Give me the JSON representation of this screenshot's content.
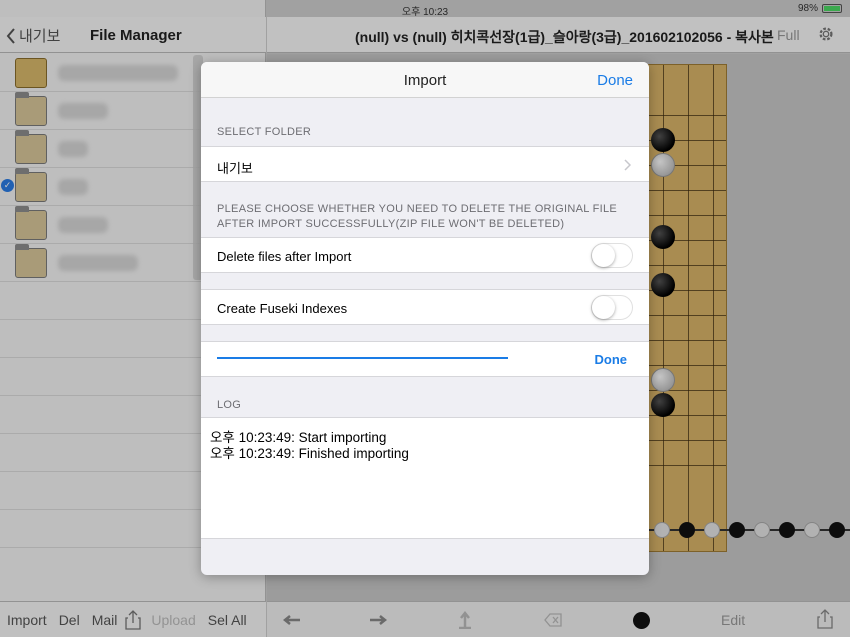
{
  "status_bar": {
    "device": "iPad",
    "time": "오후 10:23",
    "battery_text": "98%",
    "battery_level": 0.98
  },
  "left_pane": {
    "back_label": "내기보",
    "title": "File Manager",
    "toolbar": {
      "import": "Import",
      "del": "Del",
      "mail": "Mail",
      "upload": "Upload",
      "sel_all": "Sel All"
    }
  },
  "right_pane": {
    "title": "(null) vs (null)  히치콕선장(1급)_슬아랑(3급)_201602102056 - 복사본",
    "full_label": "Full",
    "edit_label": "Edit"
  },
  "modal": {
    "title": "Import",
    "done_label": "Done",
    "select_folder_header": "SELECT FOLDER",
    "folder_value": "내기보",
    "delete_header": "PLEASE CHOOSE WHETHER YOU NEED TO DELETE THE ORIGINAL FILE AFTER IMPORT SUCCESSFULLY(ZIP FILE WON'T BE DELETED)",
    "delete_toggle_label": "Delete files after Import",
    "delete_toggle_on": false,
    "fuseki_toggle_label": "Create Fuseki Indexes",
    "fuseki_toggle_on": false,
    "progress_done_label": "Done",
    "progress": 1.0,
    "log_header": "LOG",
    "log_lines": [
      "오후 10:23:49: Start importing",
      "오후 10:23:49: Finished importing"
    ]
  },
  "colors": {
    "accent": "#1a7ce6",
    "board": "#d9b468",
    "toggle_off": "#ffffff"
  }
}
